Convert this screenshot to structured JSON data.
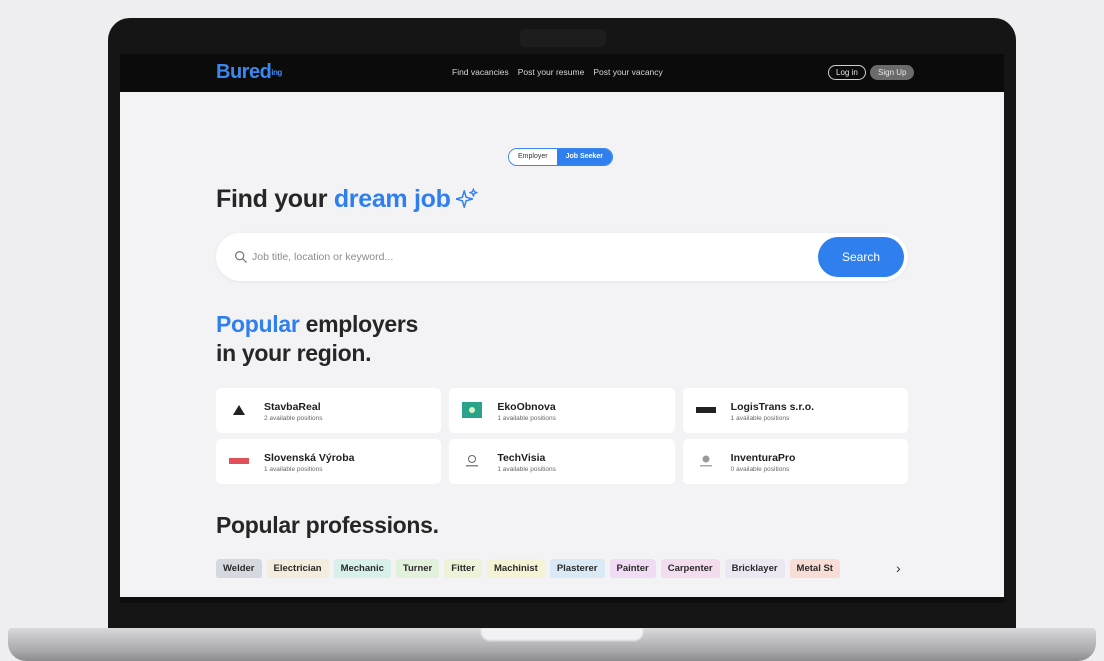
{
  "header": {
    "logo": "Bured",
    "logo_tail": "ing",
    "nav": [
      "Find vacancies",
      "Post your resume",
      "Post your vacancy"
    ],
    "login_label": "Log in",
    "signup_label": "Sign Up"
  },
  "toggle": {
    "employer_label": "Employer",
    "seeker_label": "Job Seeker",
    "active": "Job Seeker"
  },
  "hero": {
    "title_prefix": "Find your ",
    "title_accent": "dream job"
  },
  "search": {
    "placeholder": "Job title, location or keyword...",
    "button_label": "Search"
  },
  "employers_section": {
    "title_accent": "Popular",
    "title_rest": " employers",
    "title_line2": "in your region."
  },
  "employers": [
    {
      "name": "StavbaReal",
      "positions": "2 available positions",
      "logo": "triangle-logo"
    },
    {
      "name": "EkoObnova",
      "positions": "1 available positions",
      "logo": "green-square-logo"
    },
    {
      "name": "LogisTrans s.r.o.",
      "positions": "1 available positions",
      "logo": "dark-bar-logo"
    },
    {
      "name": "Slovenská Výroba",
      "positions": "1 available positions",
      "logo": "red-bar-logo"
    },
    {
      "name": "TechVisia",
      "positions": "1 available positions",
      "logo": "circle-logo"
    },
    {
      "name": "InventuraPro",
      "positions": "0 available positions",
      "logo": "round-logo"
    }
  ],
  "professions_section": {
    "title": "Popular professions."
  },
  "professions": [
    {
      "label": "Welder",
      "color": "#d5d9df"
    },
    {
      "label": "Electrician",
      "color": "#f4ecdc"
    },
    {
      "label": "Mechanic",
      "color": "#d7f1ea"
    },
    {
      "label": "Turner",
      "color": "#e1f1dc"
    },
    {
      "label": "Fitter",
      "color": "#edf3d8"
    },
    {
      "label": "Machinist",
      "color": "#f4f3d6"
    },
    {
      "label": "Plasterer",
      "color": "#d9e9f6"
    },
    {
      "label": "Painter",
      "color": "#f0dcf4"
    },
    {
      "label": "Carpenter",
      "color": "#f4dcef"
    },
    {
      "label": "Bricklayer",
      "color": "#ede7f4"
    },
    {
      "label": "Metal St",
      "color": "#f8ddd6"
    }
  ],
  "colors": {
    "accent": "#2f7fee",
    "header_bg": "#0b0b0b"
  }
}
